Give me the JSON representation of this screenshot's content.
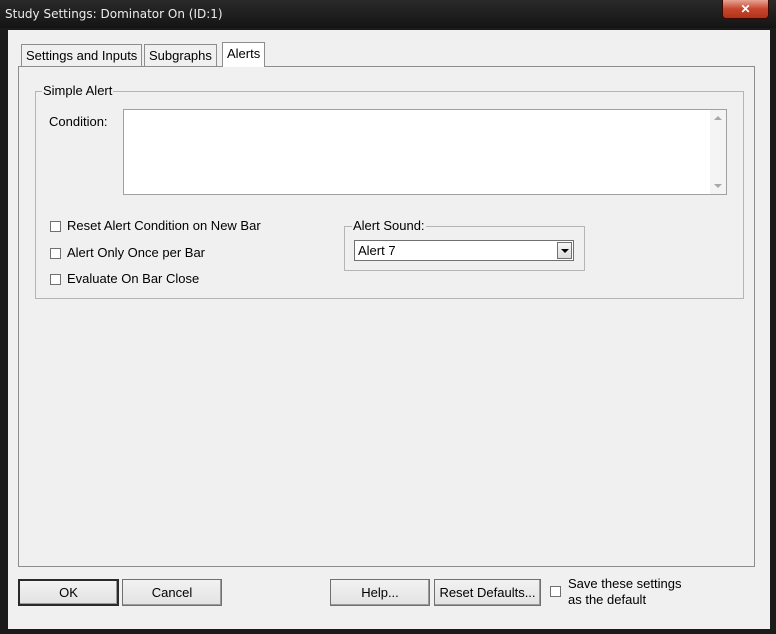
{
  "window": {
    "title": "Study Settings: Dominator On (ID:1)"
  },
  "tabs": [
    {
      "label": "Settings and Inputs"
    },
    {
      "label": "Subgraphs"
    },
    {
      "label": "Alerts"
    }
  ],
  "simple_alert": {
    "group_label": "Simple Alert",
    "condition_label": "Condition:",
    "condition_value": "",
    "checkboxes": [
      {
        "label": "Reset Alert Condition on New Bar",
        "checked": false
      },
      {
        "label": "Alert Only Once per Bar",
        "checked": false
      },
      {
        "label": "Evaluate On Bar Close",
        "checked": false
      }
    ],
    "sound": {
      "group_label": "Alert Sound:",
      "selected": "Alert 7"
    }
  },
  "buttons": {
    "ok": "OK",
    "cancel": "Cancel",
    "help": "Help...",
    "reset_defaults": "Reset Defaults...",
    "save_default_line1": "Save these settings",
    "save_default_line2": "as the default",
    "save_default_checked": false
  }
}
